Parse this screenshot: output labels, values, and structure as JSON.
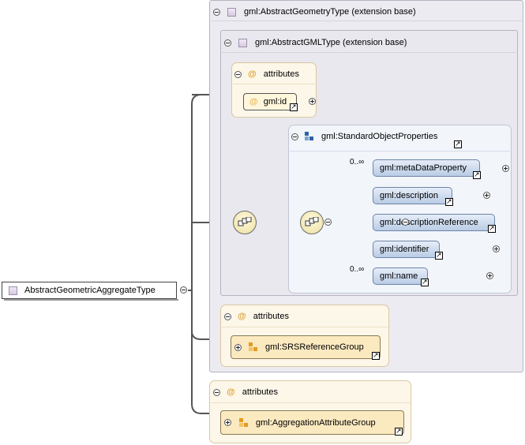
{
  "root": {
    "label": "AbstractGeometricAggregateType"
  },
  "geometry_base": {
    "label": "gml:AbstractGeometryType (extension base)"
  },
  "gml_base": {
    "label": "gml:AbstractGMLType (extension base)"
  },
  "attributes_label": "attributes",
  "id_attribute": {
    "label": "gml:id"
  },
  "standard_group": {
    "label": "gml:StandardObjectProperties",
    "elements": [
      {
        "label": "gml:metaDataProperty",
        "occurs": "0..∞"
      },
      {
        "label": "gml:description",
        "occurs": ""
      },
      {
        "label": "gml:descriptionReference",
        "occurs": ""
      },
      {
        "label": "gml:identifier",
        "occurs": ""
      },
      {
        "label": "gml:name",
        "occurs": "0..∞"
      }
    ]
  },
  "srs_group": {
    "label": "gml:SRSReferenceGroup"
  },
  "aggregation_group": {
    "label": "gml:AggregationAttributeGroup"
  },
  "colors": {
    "line": "#555555",
    "purple_panel": "#ecebf1",
    "attr_panel": "#fdf7ea",
    "element_blue": "#b9cce5",
    "attr_orange": "#e0a030"
  }
}
